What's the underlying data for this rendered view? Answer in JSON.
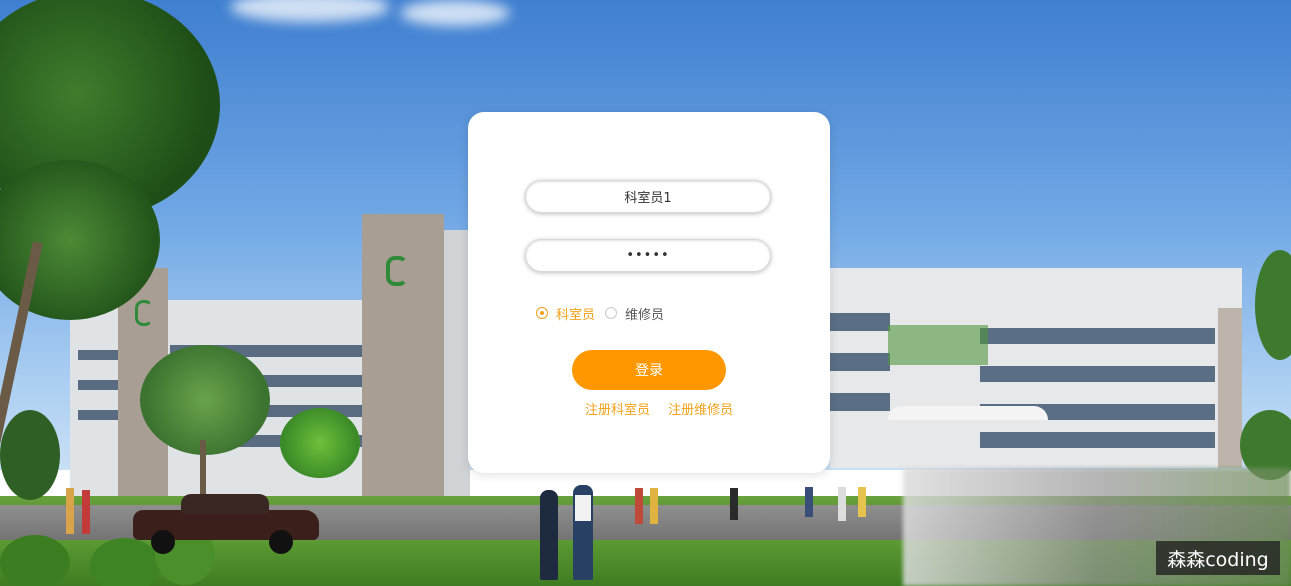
{
  "login": {
    "username_value": "科室员1",
    "password_value": "•••••",
    "roles": [
      {
        "label": "科室员",
        "selected": true
      },
      {
        "label": "维修员",
        "selected": false
      }
    ],
    "login_label": "登录",
    "links": {
      "register_staff": "注册科室员",
      "register_repair": "注册维修员"
    }
  },
  "watermark": "森森coding",
  "colors": {
    "accent": "#ff9800",
    "link": "#f0a21a",
    "card": "#ffffff"
  }
}
